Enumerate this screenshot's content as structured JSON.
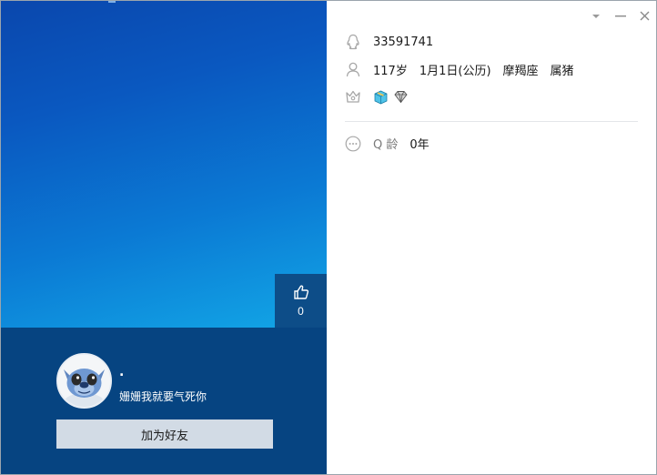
{
  "profile": {
    "qq_number": "33591741",
    "age": "117岁",
    "birthday": "1月1日(公历)",
    "constellation": "摩羯座",
    "zodiac": "属猪",
    "qage_label": "Q 龄",
    "qage_value": "0年"
  },
  "left": {
    "like_count": "0",
    "nickname": ".",
    "signature": "姗姗我就要气死你",
    "add_friend_label": "加为好友"
  },
  "icons": {
    "qq": "penguin-outline-icon",
    "profile": "person-icon",
    "badges": "crown-icon",
    "qage": "more-dots-icon",
    "like": "thumb-up-icon"
  },
  "colors": {
    "bottom_band": "#064481",
    "button_bg": "#d2dbe5",
    "icon_gray": "#a7a7a7"
  }
}
